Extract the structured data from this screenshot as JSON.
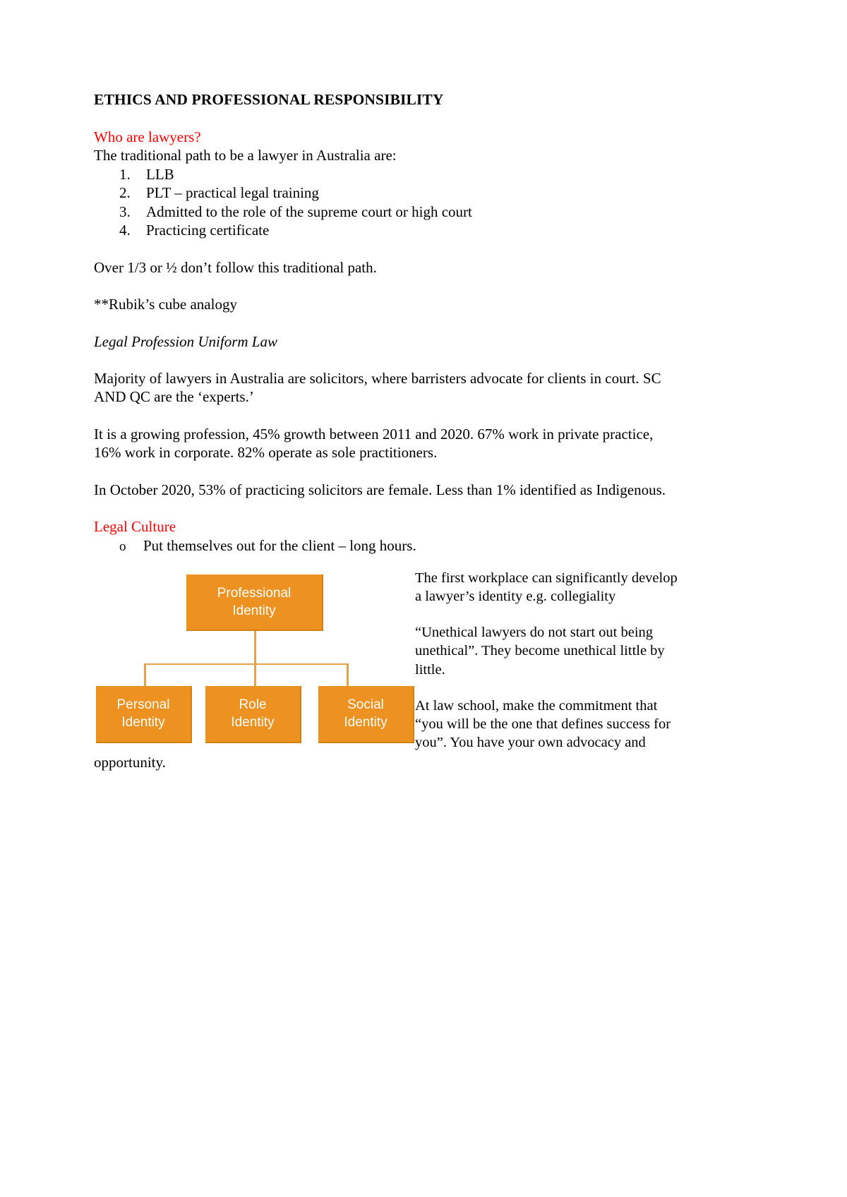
{
  "document": {
    "title": "ETHICS AND PROFESSIONAL RESPONSIBILITY",
    "sections": {
      "who_are_lawyers": {
        "heading": "Who are lawyers?",
        "intro": "The traditional path to be a lawyer in Australia are:",
        "steps": [
          {
            "num": "1.",
            "text": "LLB"
          },
          {
            "num": "2.",
            "text": "PLT – practical legal training"
          },
          {
            "num": "3.",
            "text": "Admitted to the role of the supreme court or high court"
          },
          {
            "num": "4.",
            "text": "Practicing certificate"
          }
        ],
        "note_fraction": "Over 1/3 or ½ don’t follow this traditional path.",
        "note_rubik": "**Rubik’s cube analogy"
      },
      "legal_profession_uniform_law": {
        "heading": "Legal Profession Uniform Law",
        "para_solicitors": "Majority of lawyers in Australia are solicitors, where barristers advocate for clients in court. SC AND QC are the ‘experts.’",
        "para_growth": "It is a growing profession, 45% growth between 2011 and 2020. 67% work in private practice, 16% work in corporate. 82% operate as sole practitioners.",
        "para_gender": "In October 2020, 53% of practicing solicitors are female. Less than 1% identified as Indigenous."
      },
      "legal_culture": {
        "heading": "Legal Culture",
        "bullets": [
          {
            "mark": "o",
            "text": "Put themselves out for the client – long hours."
          }
        ],
        "para_workplace": "The first workplace can significantly develop a lawyer’s identity e.g. collegiality",
        "para_unethical": "“Unethical lawyers do not start out being unethical”. They become unethical little by little.",
        "para_lawschool": "At law school, make the commitment that “you will be the one that defines success for you”. You have your own advocacy and",
        "para_lawschool_tail": "opportunity."
      }
    }
  },
  "diagram": {
    "title": "professional-identity-org-chart",
    "accent_color": "#ED9121",
    "connector_color": "#E6A24A",
    "text_color": "#FFFFFF",
    "root": {
      "line1": "Professional",
      "line2": "Identity"
    },
    "children": [
      {
        "line1": "Personal",
        "line2": "Identity"
      },
      {
        "line1": "Role",
        "line2": "Identity"
      },
      {
        "line1": "Social",
        "line2": "Identity"
      }
    ]
  },
  "colors": {
    "heading_red": "#FF0000",
    "body_black": "#000000",
    "page_background": "#FFFFFF"
  }
}
